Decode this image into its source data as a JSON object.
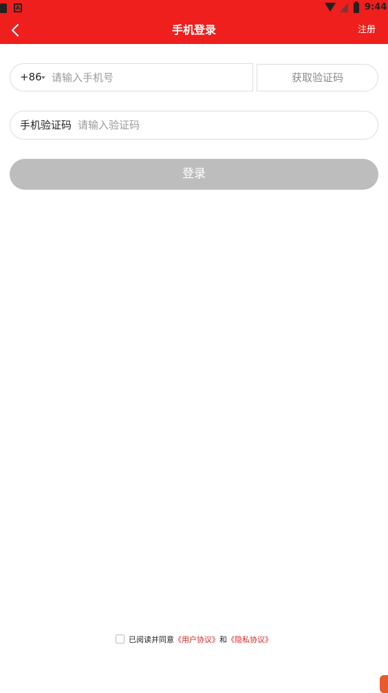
{
  "statusbar": {
    "time": "9:44",
    "left_badge": "A"
  },
  "appbar": {
    "title": "手机登录",
    "register_label": "注册"
  },
  "phone": {
    "country_code": "+86",
    "placeholder": "请输入手机号",
    "get_code_label": "获取验证码"
  },
  "sms": {
    "label": "手机验证码",
    "placeholder": "请输入验证码"
  },
  "login": {
    "label": "登录"
  },
  "agreement": {
    "prefix": "已阅读并同意",
    "user_agreement": "《用户协议》",
    "and": "和",
    "privacy_policy": "《隐私协议》"
  },
  "colors": {
    "accent": "#ee1f1c",
    "disabled_button": "#bdbdbd",
    "link": "#e02020"
  }
}
